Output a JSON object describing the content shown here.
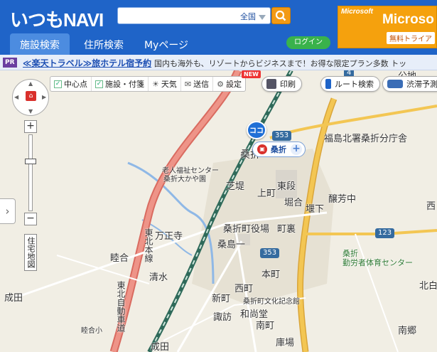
{
  "header": {
    "logo": "いつもNAVI",
    "search": {
      "placeholder": "",
      "region": "全国"
    },
    "tabs": [
      {
        "label": "施設検索",
        "active": true
      },
      {
        "label": "住所検索",
        "active": false
      },
      {
        "label": "Myページ",
        "active": false
      }
    ],
    "login": "ログイン",
    "ad": {
      "brand": "Microsoft",
      "title": "Microso",
      "sub": "無料トライア"
    }
  },
  "pr": {
    "badge": "PR",
    "link": "≪楽天トラベル≫旅ホテル宿予約",
    "text": "国内も海外も、リゾートからビジネスまで！お得な限定プラン多数 トッ"
  },
  "toolbar": {
    "items": [
      "中心点",
      "施設・付箋",
      "天気",
      "送信",
      "設定"
    ],
    "new_badge": "NEW",
    "print": "印刷",
    "route": "ルート検索",
    "traffic": "渋滞予測"
  },
  "nav": {
    "zoom_in": "+",
    "zoom_out": "−",
    "map_type": "住宅地図",
    "side_toggle": "›"
  },
  "markers": {
    "here": "ココ",
    "station": "桑折"
  },
  "routes": [
    "353",
    "353",
    "123",
    "4"
  ],
  "map_labels": {
    "police": "福島北署桑折分庁舎",
    "kuwaori_main": "桑折",
    "nursing": "老人福祉センター",
    "nursing2": "桑折大かや園",
    "shidou": "芝堤",
    "kamimachi": "上町",
    "higashidan": "東段",
    "horiai": "堀合",
    "hiyoshi": "醸芳中",
    "hayashita": "堰下",
    "manshouji": "万正寺",
    "town_office": "桑折町役場",
    "machiura": "町裏",
    "kuwaori1": "桑島一",
    "mutsuai": "睦合",
    "tohoku_line": "東北本線",
    "shimizu": "清水",
    "kimachi": "本町",
    "nishimachi": "西町",
    "shinmachi": "新町",
    "museum": "桑折町文化記念館",
    "wadoudou": "和尚堂",
    "kuwaori_gym1": "桑折",
    "kuwaori_gym2": "勤労者体育センター",
    "kitashirane": "北白",
    "suwa": "諏訪",
    "minamimachi": "南町",
    "expressway": "東北自動車道",
    "nanbu": "南郷",
    "mutsuai_elem": "睦合小",
    "seita": "成田",
    "kuraba": "庫場",
    "narita": "成田",
    "shikida": "成田",
    "nishi": "西",
    "kita": "北",
    "e1": "公地"
  },
  "colors": {
    "header": "#1f64c8",
    "expressway": "#e9837a",
    "national_road": "#f2c04e",
    "railway": "#2f6a5a",
    "river": "#8fb8e6"
  }
}
